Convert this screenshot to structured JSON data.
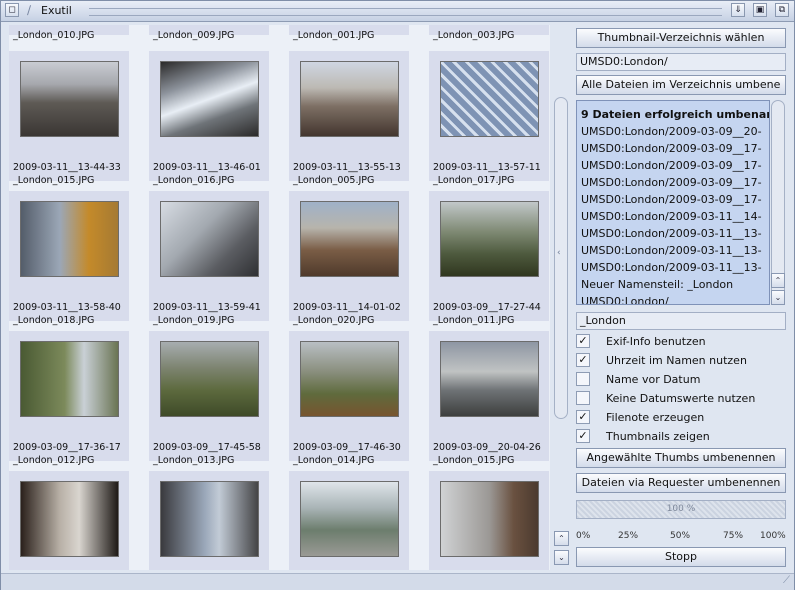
{
  "window": {
    "title": "Exutil"
  },
  "grid": {
    "top_captions": [
      "_London_010.JPG",
      "_London_009.JPG",
      "_London_001.JPG",
      "_London_003.JPG"
    ],
    "rows": [
      [
        {
          "line1": "2009-03-11__13-44-33",
          "line2": "_London_015.JPG"
        },
        {
          "line1": "2009-03-11__13-46-01",
          "line2": "_London_016.JPG"
        },
        {
          "line1": "2009-03-11__13-55-13",
          "line2": "_London_005.JPG"
        },
        {
          "line1": "2009-03-11__13-57-11",
          "line2": "_London_017.JPG"
        }
      ],
      [
        {
          "line1": "2009-03-11__13-58-40",
          "line2": "_London_018.JPG"
        },
        {
          "line1": "2009-03-11__13-59-41",
          "line2": "_London_019.JPG"
        },
        {
          "line1": "2009-03-11__14-01-02",
          "line2": "_London_020.JPG"
        },
        {
          "line1": "2009-03-09__17-27-44",
          "line2": "_London_011.JPG"
        }
      ],
      [
        {
          "line1": "2009-03-09__17-36-17",
          "line2": "_London_012.JPG"
        },
        {
          "line1": "2009-03-09__17-45-58",
          "line2": "_London_013.JPG"
        },
        {
          "line1": "2009-03-09__17-46-30",
          "line2": "_London_014.JPG"
        },
        {
          "line1": "2009-03-09__20-04-26",
          "line2": "_London_015.JPG"
        }
      ]
    ]
  },
  "panel": {
    "choose_dir_label": "Thumbnail-Verzeichnis wählen",
    "dir_path": "UMSD0:London/",
    "rename_all_label": "Alle Dateien im Verzeichnis umbene",
    "log_lines": [
      "9 Dateien erfolgreich umbenann",
      "UMSD0:London/2009-03-09__20-",
      "UMSD0:London/2009-03-09__17-",
      "UMSD0:London/2009-03-09__17-",
      "UMSD0:London/2009-03-09__17-",
      "UMSD0:London/2009-03-09__17-",
      "UMSD0:London/2009-03-11__14-",
      "UMSD0:London/2009-03-11__13-",
      "UMSD0:London/2009-03-11__13-",
      "UMSD0:London/2009-03-11__13-",
      "Neuer Namensteil: _London",
      "UMSD0:London/"
    ],
    "name_part": "_London",
    "options": [
      {
        "label": "Exif-Info benutzen",
        "checked": true
      },
      {
        "label": "Uhrzeit im Namen nutzen",
        "checked": true
      },
      {
        "label": "Name vor Datum",
        "checked": false
      },
      {
        "label": "Keine Datumswerte nutzen",
        "checked": false
      },
      {
        "label": "Filenote erzeugen",
        "checked": true
      },
      {
        "label": "Thumbnails zeigen",
        "checked": true
      }
    ],
    "rename_selected_label": "Angewählte Thumbs umbenennen",
    "rename_requester_label": "Dateien via Requester umbenennen",
    "progress": {
      "value": 100,
      "label": "100 %"
    },
    "scale": [
      "0%",
      "25%",
      "50%",
      "75%",
      "100%"
    ],
    "stop_label": "Stopp"
  }
}
